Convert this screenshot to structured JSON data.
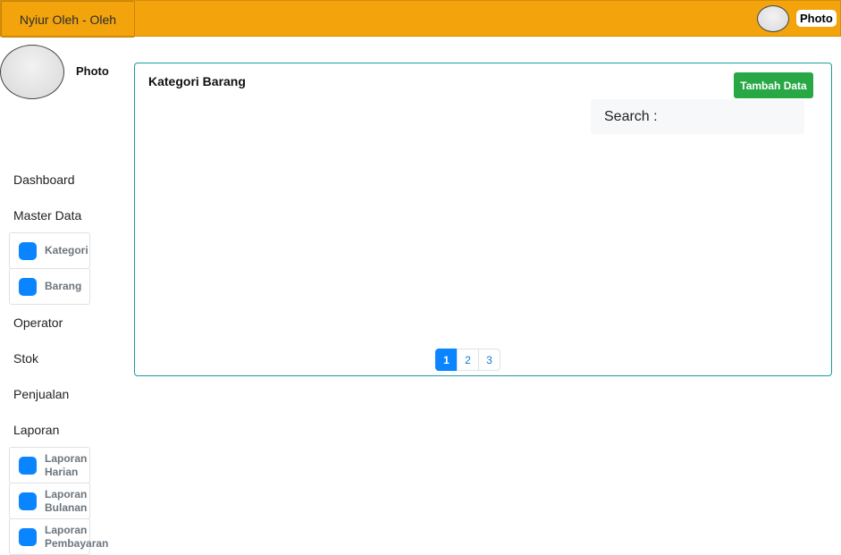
{
  "header": {
    "brand": "Nyiur Oleh - Oleh",
    "profile_label": "Photo"
  },
  "sidebar": {
    "profile_label": "Photo",
    "items": [
      {
        "label": "Dashboard"
      },
      {
        "label": "Master Data",
        "children": [
          "Kategori",
          "Barang"
        ]
      },
      {
        "label": "Operator"
      },
      {
        "label": "Stok"
      },
      {
        "label": "Penjualan"
      },
      {
        "label": "Laporan",
        "children": [
          "Laporan Harian",
          "Laporan Bulanan",
          "Laporan Pembayaran"
        ]
      }
    ]
  },
  "main": {
    "title": "Kategori Barang",
    "add_button": "Tambah Data",
    "search_label": "Search :",
    "search_value": "",
    "pagination": {
      "pages": [
        "1",
        "2",
        "3"
      ],
      "active": "1"
    }
  },
  "colors": {
    "header_bg": "#f3a40d",
    "accent_blue": "#0a84ff",
    "add_button_bg": "#28a745",
    "panel_border": "#1a9e9a"
  },
  "icons": {
    "sub_item": "square-icon"
  }
}
